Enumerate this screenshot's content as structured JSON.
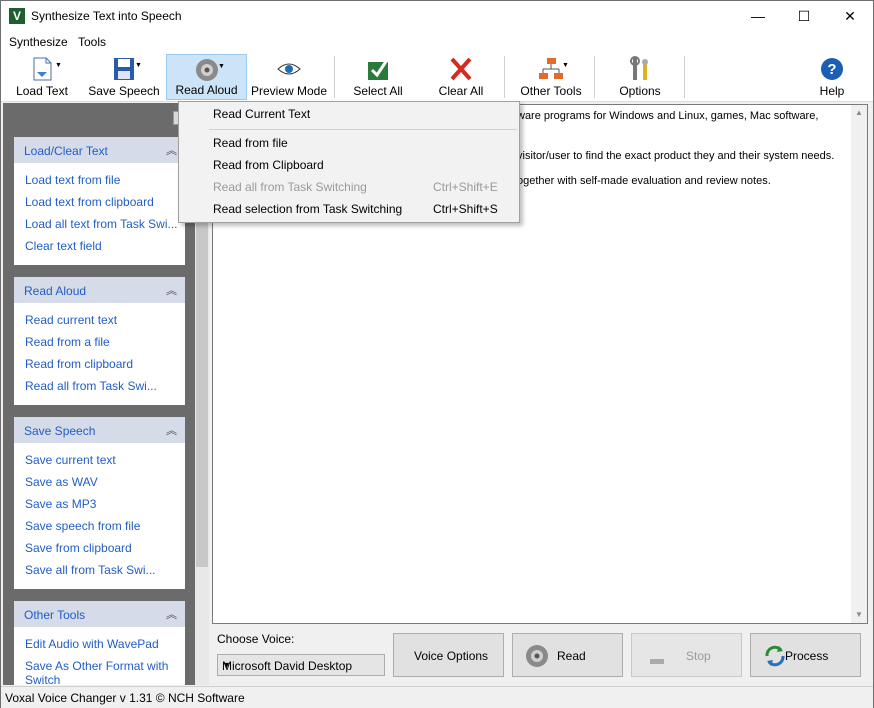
{
  "window": {
    "title": "Synthesize Text into Speech",
    "app_icon_letter": "V",
    "min_glyph": "—",
    "max_glyph": "☐",
    "close_glyph": "✕"
  },
  "menubar": [
    "Synthesize",
    "Tools"
  ],
  "toolbar": {
    "load_text": "Load Text",
    "save_speech": "Save Speech",
    "read_aloud": "Read Aloud",
    "preview_mode": "Preview Mode",
    "select_all": "Select All",
    "clear_all": "Clear All",
    "other_tools": "Other Tools",
    "options": "Options",
    "help": "Help"
  },
  "sidebar": {
    "panels": [
      {
        "title": "Load/Clear Text",
        "items": [
          "Load text from file",
          "Load text from clipboard",
          "Load all text from Task Swi...",
          "Clear text field"
        ]
      },
      {
        "title": "Read Aloud",
        "items": [
          "Read current text",
          "Read from a file",
          "Read from clipboard",
          "Read all from Task Swi..."
        ]
      },
      {
        "title": "Save Speech",
        "items": [
          "Save current text",
          "Save as WAV",
          "Save as MP3",
          "Save speech from file",
          "Save from clipboard",
          "Save all from Task Swi..."
        ]
      },
      {
        "title": "Other Tools",
        "items": [
          "Edit Audio with WavePad",
          "Save As Other Format with Switch"
        ]
      }
    ]
  },
  "editor": {
    "lines": [
      "ware programs for Windows and Linux, games, Mac software,",
      "visitor/user to find the exact product they and their system needs.",
      "ogether with self-made evaluation and review notes."
    ]
  },
  "dropdown": {
    "items": [
      {
        "label": "Read Current Text",
        "shortcut": "",
        "disabled": false
      },
      {
        "label": "Read from file",
        "shortcut": "",
        "disabled": false
      },
      {
        "label": "Read from Clipboard",
        "shortcut": "",
        "disabled": false
      },
      {
        "label": "Read all from Task Switching",
        "shortcut": "Ctrl+Shift+E",
        "disabled": true
      },
      {
        "label": "Read selection from Task Switching",
        "shortcut": "Ctrl+Shift+S",
        "disabled": false
      }
    ]
  },
  "bottom": {
    "choose_voice_label": "Choose Voice:",
    "voice_value": "Microsoft David Desktop",
    "voice_options": "Voice Options",
    "read": "Read",
    "stop": "Stop",
    "process": "Process"
  },
  "status": {
    "text": "Voxal Voice Changer v 1.31 © NCH Software"
  },
  "colors": {
    "link_blue": "#215dc6",
    "panel_header": "#d6dbe9",
    "active_button": "#cce4f7"
  }
}
